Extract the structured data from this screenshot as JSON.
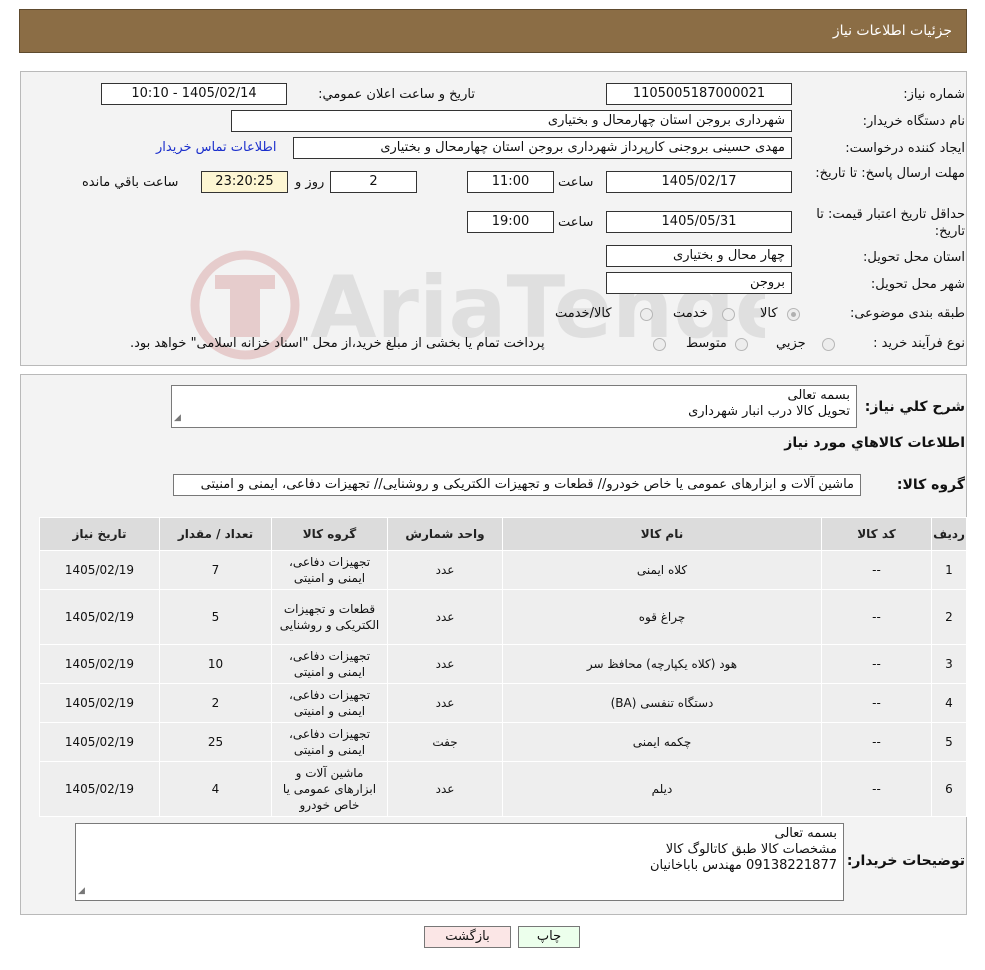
{
  "header": {
    "title": "جزئیات اطلاعات نیاز"
  },
  "info": {
    "need_number_label": "شماره نیاز:",
    "need_number": "1105005187000021",
    "announce_label": "تاریخ و ساعت اعلان عمومي:",
    "announce_value": "1405/02/14 - 10:10",
    "buyer_org_label": "نام دستگاه خريدار:",
    "buyer_org": "شهرداری بروجن استان چهارمحال و بختیاری",
    "creator_label": "ايجاد کننده درخواست:",
    "creator": "مهدی حسینی بروجنی کارپرداز شهرداری بروجن استان چهارمحال و بختیاری",
    "contact_link": "اطلاعات تماس خريدار",
    "reply_deadline_label": "مهلت ارسال پاسخ: تا تاريخ:",
    "reply_date": "1405/02/17",
    "time_label": "ساعت",
    "reply_time": "11:00",
    "days": "2",
    "days_label": "روز و",
    "remaining": "23:20:25",
    "remaining_label": "ساعت باقي مانده",
    "validity_label": "حداقل تاريخ اعتبار قيمت: تا تاريخ:",
    "validity_date": "1405/05/31",
    "validity_time": "19:00",
    "province_label": "استان محل تحويل:",
    "province": "چهار محال و بختیاری",
    "city_label": "شهر محل تحويل:",
    "city": "بروجن",
    "category_label": "طبقه بندی موضوعی:",
    "category_options": [
      "کالا",
      "خدمت",
      "کالا/خدمت"
    ],
    "process_label": "نوع فرآيند خريد :",
    "process_options": [
      "جزیي",
      "متوسط"
    ],
    "process_note": "پرداخت تمام يا بخشی از مبلغ خريد،از محل \"اسناد خزانه اسلامی\" خواهد بود."
  },
  "description": {
    "label": "شرح كلي نياز:",
    "lines": [
      "بسمه تعالی",
      "تحویل کالا درب انبار شهرداری"
    ]
  },
  "goods_title": "اطلاعات كالاهاي مورد نياز",
  "group": {
    "label": "گروه کالا:",
    "value": "ماشین آلات و ابزارهای عمومی یا خاص خودرو// قطعات و تجهیزات الکتریکی و روشنایی// تجهیزات دفاعی، ایمنی و امنیتی"
  },
  "table": {
    "headers": [
      "رديف",
      "کد کالا",
      "نام کالا",
      "واحد شمارش",
      "گروه کالا",
      "تعداد / مقدار",
      "تاريخ نياز"
    ],
    "rows": [
      {
        "row": "1",
        "code": "--",
        "name": "کلاه ایمنی",
        "unit": "عدد",
        "group": "تجهیزات دفاعی، ایمنی و امنیتی",
        "qty": "7",
        "date": "1405/02/19"
      },
      {
        "row": "2",
        "code": "--",
        "name": "چراغ قوه",
        "unit": "عدد",
        "group": "قطعات و تجهیزات الکتریکی و روشنایی",
        "qty": "5",
        "date": "1405/02/19"
      },
      {
        "row": "3",
        "code": "--",
        "name": "هود (کلاه یکپارچه) محافظ سر",
        "unit": "عدد",
        "group": "تجهیزات دفاعی، ایمنی و امنیتی",
        "qty": "10",
        "date": "1405/02/19"
      },
      {
        "row": "4",
        "code": "--",
        "name": "دستگاه تنفسی (BA)",
        "unit": "عدد",
        "group": "تجهیزات دفاعی، ایمنی و امنیتی",
        "qty": "2",
        "date": "1405/02/19"
      },
      {
        "row": "5",
        "code": "--",
        "name": "چکمه ایمنی",
        "unit": "جفت",
        "group": "تجهیزات دفاعی، ایمنی و امنیتی",
        "qty": "25",
        "date": "1405/02/19"
      },
      {
        "row": "6",
        "code": "--",
        "name": "دیلم",
        "unit": "عدد",
        "group": "ماشین آلات و ابزارهای عمومی یا خاص خودرو",
        "qty": "4",
        "date": "1405/02/19"
      }
    ]
  },
  "buyer_notes": {
    "label": "توضيحات خريدار:",
    "lines": [
      "بسمه تعالی",
      "مشخصات کالا طبق کاتالوگ کالا",
      "09138221877 مهندس باباخانیان"
    ]
  },
  "buttons": {
    "print": "چاپ",
    "back": "بازگشت"
  },
  "watermark": {
    "text": "AriaTender.neT"
  }
}
